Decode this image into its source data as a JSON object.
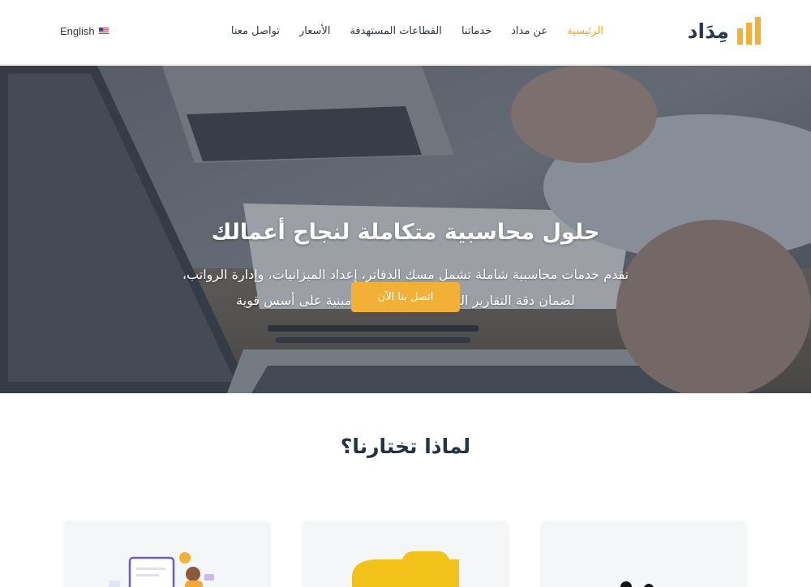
{
  "header": {
    "logo_text": "مِدَاد",
    "nav": [
      {
        "label": "الرئيسية",
        "active": true
      },
      {
        "label": "عن مداد",
        "active": false
      },
      {
        "label": "خدماتنا",
        "active": false
      },
      {
        "label": "القطاعات المستهدفة",
        "active": false
      },
      {
        "label": "الأسعار",
        "active": false
      },
      {
        "label": "تواصل معنا",
        "active": false
      }
    ],
    "language": {
      "label": "English",
      "icon": "us-flag-icon"
    }
  },
  "hero": {
    "title": "حلول محاسبية متكاملة لنجاح أعمالك",
    "description_line1": "نقدم خدمات محاسبية شاملة تشمل مسك الدفاتر، إعداد الميزانيات، وإدارة الرواتب،",
    "description_line2": "لضمان دقة التقارير المالية واتخاذ قرارات مبنية على أسس قوية",
    "cta_label": "اتصل بنا الآن"
  },
  "why": {
    "title": "لماذا تختارنا؟",
    "cards": [
      {
        "icon": "user-illustration-icon"
      },
      {
        "icon": "shield-illustration-icon"
      },
      {
        "icon": "team-illustration-icon"
      }
    ]
  },
  "colors": {
    "accent": "#f2b136",
    "active_nav": "#eaa52a",
    "dark_text": "#26323f"
  }
}
